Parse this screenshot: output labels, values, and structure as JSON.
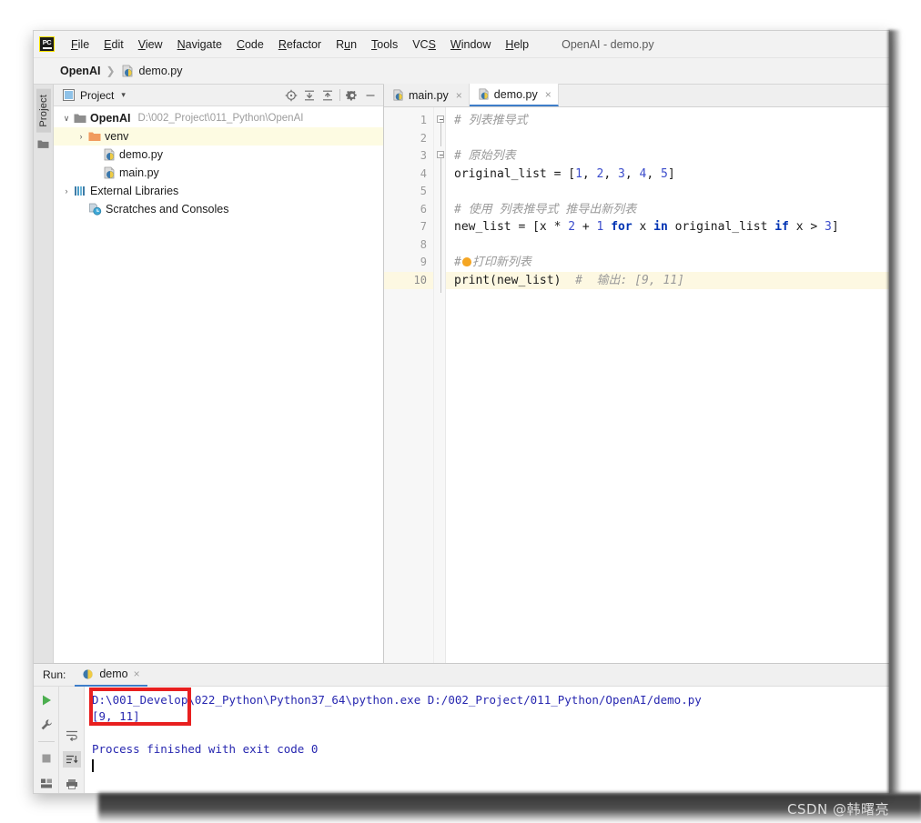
{
  "window": {
    "title": "OpenAI - demo.py"
  },
  "menubar": {
    "items": [
      {
        "label": "File",
        "mnemonic": "F"
      },
      {
        "label": "Edit",
        "mnemonic": "E"
      },
      {
        "label": "View",
        "mnemonic": "V"
      },
      {
        "label": "Navigate",
        "mnemonic": "N"
      },
      {
        "label": "Code",
        "mnemonic": "C"
      },
      {
        "label": "Refactor",
        "mnemonic": "R"
      },
      {
        "label": "Run",
        "mnemonic": "u"
      },
      {
        "label": "Tools",
        "mnemonic": "T"
      },
      {
        "label": "VCS",
        "mnemonic": "S"
      },
      {
        "label": "Window",
        "mnemonic": "W"
      },
      {
        "label": "Help",
        "mnemonic": "H"
      }
    ],
    "logo_text": "PC"
  },
  "breadcrumb": {
    "root": "OpenAI",
    "separator": "❯",
    "file": "demo.py"
  },
  "toolstrip": {
    "project_tab": "Project"
  },
  "project_panel": {
    "header_title": "Project",
    "caret": "▾",
    "icons": [
      "locate-icon",
      "expand-all-icon",
      "collapse-all-icon",
      "gear-icon",
      "hide-icon"
    ],
    "tree": [
      {
        "indent": 0,
        "twisty": "∨",
        "icon": "folder-icon",
        "label": "OpenAI",
        "bold": true,
        "path": "D:\\002_Project\\011_Python\\OpenAI",
        "selected": false
      },
      {
        "indent": 1,
        "twisty": "›",
        "icon": "folder-orange-icon",
        "label": "venv",
        "bold": false,
        "path": "",
        "selected": true
      },
      {
        "indent": 2,
        "twisty": "",
        "icon": "python-file-icon",
        "label": "demo.py",
        "bold": false,
        "path": "",
        "selected": false
      },
      {
        "indent": 2,
        "twisty": "",
        "icon": "python-file-icon",
        "label": "main.py",
        "bold": false,
        "path": "",
        "selected": false
      },
      {
        "indent": 0,
        "twisty": "›",
        "icon": "libraries-icon",
        "label": "External Libraries",
        "bold": false,
        "path": "",
        "selected": false
      },
      {
        "indent": 0,
        "twisty": "",
        "icon": "scratches-icon",
        "label": "Scratches and Consoles",
        "bold": false,
        "path": "",
        "selected": false
      }
    ]
  },
  "editor": {
    "tabs": [
      {
        "label": "main.py",
        "active": false,
        "close": "×"
      },
      {
        "label": "demo.py",
        "active": true,
        "close": "×"
      }
    ],
    "current_line": 10,
    "lines": [
      {
        "n": "1",
        "fold": true,
        "text": "# 列表推导式",
        "kind": "comment"
      },
      {
        "n": "2",
        "fold": false,
        "text": "",
        "kind": "plain"
      },
      {
        "n": "3",
        "fold": true,
        "text": "# 原始列表",
        "kind": "comment"
      },
      {
        "n": "4",
        "fold": false,
        "text": "original_list = [1, 2, 3, 4, 5]",
        "kind": "code_list"
      },
      {
        "n": "5",
        "fold": false,
        "text": "",
        "kind": "plain"
      },
      {
        "n": "6",
        "fold": false,
        "text": "# 使用 列表推导式 推导出新列表",
        "kind": "comment"
      },
      {
        "n": "7",
        "fold": false,
        "text": "new_list = [x * 2 + 1 for x in original_list if x > 3]",
        "kind": "code_comp"
      },
      {
        "n": "8",
        "fold": false,
        "text": "",
        "kind": "plain"
      },
      {
        "n": "9",
        "fold": false,
        "text": "#打印新列表",
        "kind": "comment_bulb"
      },
      {
        "n": "10",
        "fold": false,
        "text": "print(new_list)  # 输出: [9, 11]",
        "kind": "code_print"
      }
    ]
  },
  "run_panel": {
    "run_label": "Run:",
    "tab_label": "demo",
    "tab_close": "×",
    "tools_primary": [
      "run-icon",
      "settings-wrench-icon",
      "stop-icon",
      "layout-icon"
    ],
    "tools_secondary": [
      "soft-wrap-icon",
      "scroll-to-end-icon",
      "print-icon"
    ],
    "console": {
      "command": "D:\\001_Develop\\022_Python\\Python37_64\\python.exe D:/002_Project/011_Python/OpenAI/demo.py",
      "output": "[9, 11]",
      "blank": "",
      "status": "Process finished with exit code 0"
    },
    "annotation": {
      "color": "#e81f1f",
      "target": "[9, 11]"
    }
  },
  "watermark": {
    "text": "CSDN @韩曙亮"
  },
  "colors": {
    "accent_blue": "#3d7dc9",
    "console_text": "#2727b0",
    "current_line_bg": "#fdf8e2",
    "selection_bg": "#fdfbe2",
    "annotation_red": "#e81f1f"
  }
}
